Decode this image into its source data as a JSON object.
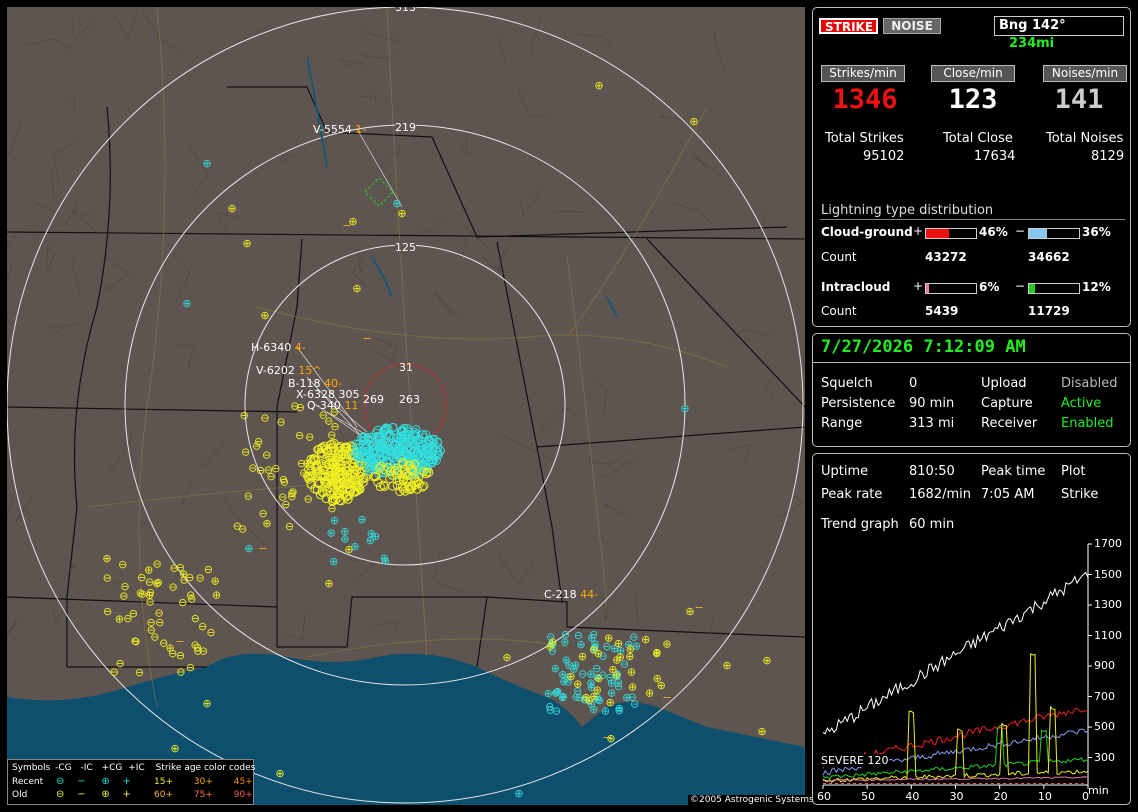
{
  "map": {
    "range_labels": [
      "313",
      "219",
      "125",
      "31"
    ],
    "sites": [
      {
        "label": "V-5554",
        "suffix": "1-"
      },
      {
        "label": "H-6340",
        "suffix": "4-"
      },
      {
        "label": "V-6202",
        "suffix": "15^"
      },
      {
        "label": "B-118",
        "suffix": "40-"
      },
      {
        "label": "X-6328",
        "suffix": "305"
      },
      {
        "label": "Q-340",
        "suffix": "11"
      },
      {
        "label": "C-218",
        "suffix": "44-"
      }
    ],
    "overlap_labels": [
      "269",
      "263"
    ],
    "copyright": "©2005 Astrogenic Systems",
    "legend": {
      "row0": [
        "Symbols",
        "-CG",
        "-IC",
        "+CG",
        "+IC",
        "Strike age color codes"
      ],
      "recent_label": "Recent",
      "old_label": "Old",
      "recent_ages": [
        "15+",
        "30+",
        "45+"
      ],
      "old_ages": [
        "60+",
        "75+",
        "90+"
      ]
    }
  },
  "top_panel": {
    "strike_btn": "STRIKE",
    "noise_btn": "NOISE",
    "bearing": "Bng 142°",
    "distance": "234mi",
    "headers": [
      "Strikes/min",
      "Close/min",
      "Noises/min"
    ],
    "rates": [
      "1346",
      "123",
      "141"
    ],
    "totals_labels": [
      "Total Strikes",
      "Total Close",
      "Total Noises"
    ],
    "totals_values": [
      "95102",
      "17634",
      "8129"
    ],
    "dist_title": "Lightning type distribution",
    "cloud_ground": "Cloud-ground",
    "intracloud": "Intracloud",
    "count": "Count",
    "plus": "+",
    "minus": "−",
    "cg_pos_pct": "46%",
    "cg_neg_pct": "36%",
    "cg_pos_count": "43272",
    "cg_neg_count": "34662",
    "ic_pos_pct": "6%",
    "ic_neg_pct": "12%",
    "ic_pos_count": "5439",
    "ic_neg_count": "11729",
    "bars": {
      "cg_pos": 46,
      "cg_neg": 36,
      "ic_pos": 6,
      "ic_neg": 12
    },
    "colors": {
      "cg_pos": "#ee1111",
      "cg_neg": "#88c8f0",
      "ic_pos": "#e878a8",
      "ic_neg": "#22cc22"
    }
  },
  "status_panel": {
    "datetime": "7/27/2026 7:12:09 AM",
    "squelch_label": "Squelch",
    "squelch": "0",
    "persistence_label": "Persistence",
    "persistence": "90 min",
    "range_label": "Range",
    "range": "313 mi",
    "upload_label": "Upload",
    "upload": "Disabled",
    "capture_label": "Capture",
    "capture": "Active",
    "receiver_label": "Receiver",
    "receiver": "Enabled"
  },
  "trend_panel": {
    "uptime_label": "Uptime",
    "uptime": "810:50",
    "peak_time_label": "Peak time",
    "peak_time": "7:05 AM",
    "plot_label": "Plot",
    "plot": "Strike",
    "peak_rate_label": "Peak rate",
    "peak_rate": "1682/min",
    "trend_label": "Trend graph",
    "trend": "60 min",
    "severe": "SEVERE 120",
    "y_ticks": [
      "1700",
      "1500",
      "1300",
      "1100",
      "900",
      "700",
      "500",
      "300"
    ],
    "x_ticks": [
      "60",
      "50",
      "40",
      "30",
      "20",
      "10",
      "0"
    ],
    "x_unit": "min"
  }
}
